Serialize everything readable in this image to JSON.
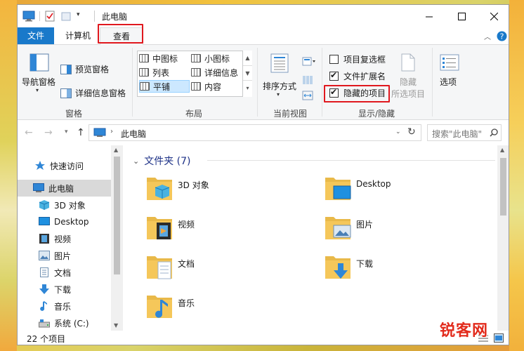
{
  "window": {
    "title": "此电脑"
  },
  "tabs": {
    "file": "文件",
    "computer": "计算机",
    "view": "查看"
  },
  "ribbon": {
    "panes": {
      "nav_pane": "导航窗格",
      "preview_pane": "预览窗格",
      "details_pane": "详细信息窗格",
      "label": "窗格"
    },
    "layout": {
      "label": "布局",
      "items": [
        "中图标",
        "小图标",
        "列表",
        "详细信息",
        "平铺",
        "内容"
      ],
      "selected": "平铺"
    },
    "current_view": {
      "sort_by": "排序方式",
      "label": "当前视图"
    },
    "show_hide": {
      "item_checkboxes": "项目复选框",
      "file_extensions": "文件扩展名",
      "hidden_items": "隐藏的项目",
      "hide_selected_line1": "隐藏",
      "hide_selected_line2": "所选项目",
      "label": "显示/隐藏",
      "checked": {
        "item_checkboxes": false,
        "file_extensions": true,
        "hidden_items": true
      }
    },
    "options": "选项"
  },
  "address": {
    "path": "此电脑",
    "search_placeholder": "搜索\"此电脑\""
  },
  "nav": {
    "items": [
      "快速访问",
      "此电脑",
      "3D 对象",
      "Desktop",
      "视频",
      "图片",
      "文档",
      "下载",
      "音乐",
      "系统 (C:)"
    ],
    "selected": "此电脑"
  },
  "content": {
    "group_title": "文件夹 (7)",
    "folders": [
      "3D 对象",
      "Desktop",
      "视频",
      "图片",
      "文档",
      "下载",
      "音乐"
    ]
  },
  "status": {
    "count": "22 个项目"
  },
  "watermark": "锐客网",
  "colors": {
    "accent": "#1979ca",
    "highlight": "#e0181e",
    "folder": "#f5c75a"
  }
}
